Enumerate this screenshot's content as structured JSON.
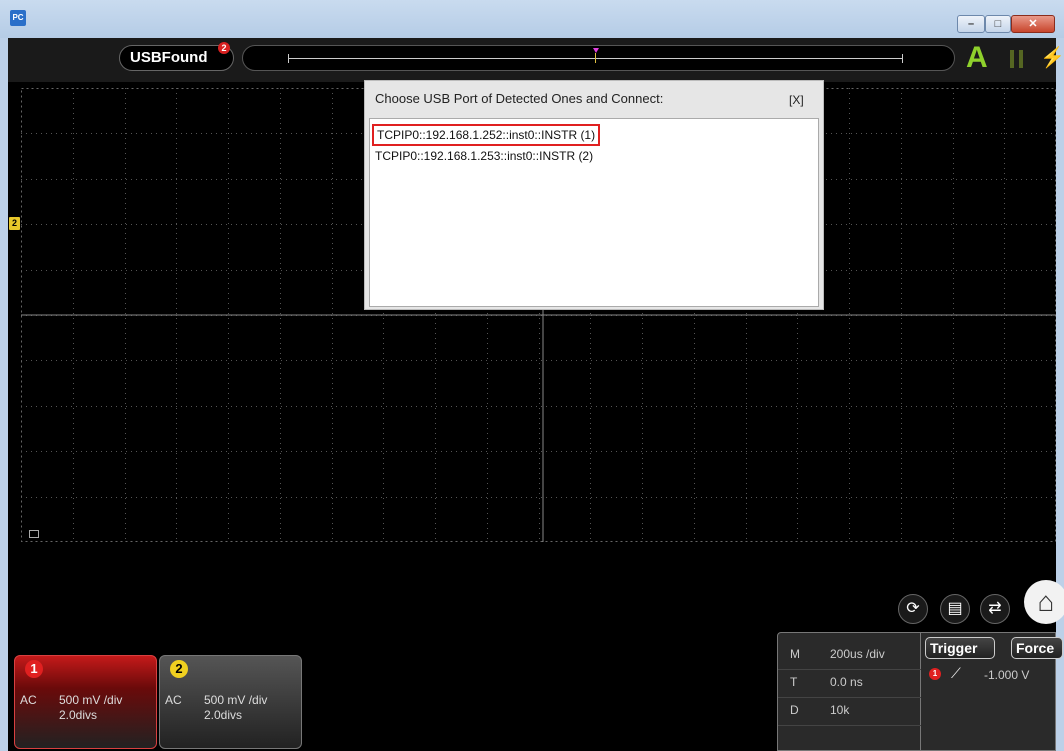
{
  "window": {
    "app_icon_text": "PC",
    "min_glyph": "–",
    "max_glyph": "□",
    "close_glyph": "✕"
  },
  "topbar": {
    "connection_label": "USBFound",
    "connection_badge": "2",
    "auto_glyph": "A",
    "run_glyph": "⚡"
  },
  "scope": {
    "ch2_marker": "2"
  },
  "dialog": {
    "title": "Choose USB Port of Detected Ones and Connect:",
    "close_label": "[X]",
    "ports": [
      {
        "label": "TCPIP0::192.168.1.252::inst0::INSTR  (1)",
        "selected": true
      },
      {
        "label": "TCPIP0::192.168.1.253::inst0::INSTR  (2)",
        "selected": false
      }
    ]
  },
  "channels": [
    {
      "num": "1",
      "coupling": "AC",
      "scale": "500 mV /div",
      "position": "2.0divs",
      "color": "#e02020"
    },
    {
      "num": "2",
      "coupling": "AC",
      "scale": "500 mV /div",
      "position": "2.0divs",
      "color": "#f0d020"
    }
  ],
  "timebase": {
    "rows": [
      {
        "key": "M",
        "value": "200us /div"
      },
      {
        "key": "T",
        "value": "0.0 ns"
      },
      {
        "key": "D",
        "value": "10k"
      }
    ]
  },
  "trigger": {
    "trigger_label": "Trigger",
    "force_label": "Force",
    "source": "1",
    "edge_glyph": "⟋",
    "level": "-1.000 V"
  },
  "tools": {
    "icons": [
      "auto-set-icon",
      "save-icon",
      "swap-icon",
      "home-icon"
    ]
  }
}
